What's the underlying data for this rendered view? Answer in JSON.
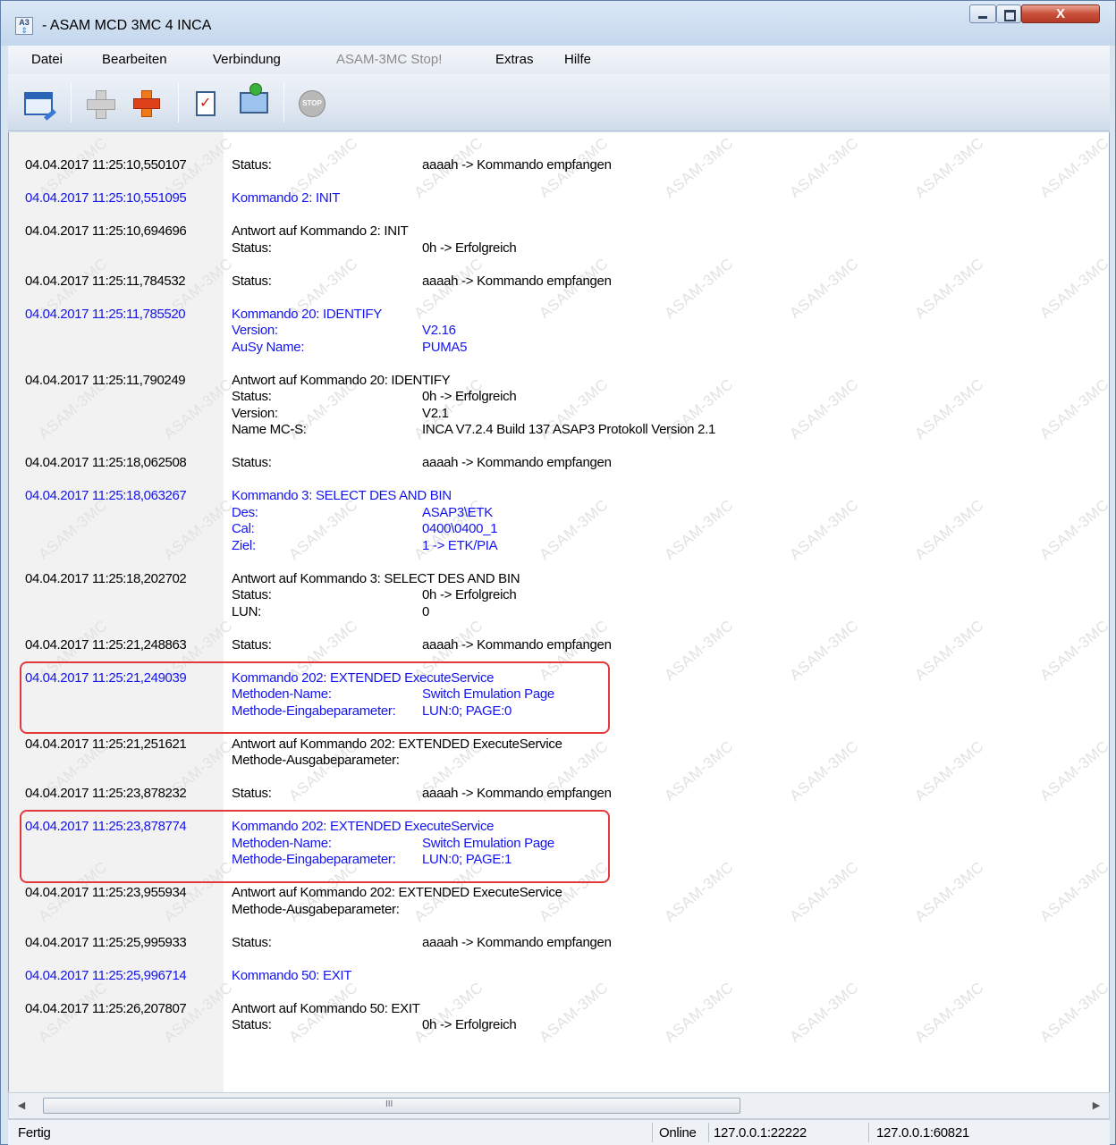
{
  "window": {
    "title": "- ASAM MCD 3MC 4 INCA",
    "icon": "asam-app-icon",
    "icon_text": "A3",
    "close_glyph": "X"
  },
  "menu": {
    "items": [
      "Datei",
      "Bearbeiten",
      "Verbindung",
      "ASAM-3MC Stop!",
      "Extras",
      "Hilfe"
    ]
  },
  "toolbar": {
    "buttons": [
      {
        "icon": "open-window-icon"
      },
      {
        "icon": "add-icon",
        "enabled": false
      },
      {
        "icon": "remove-icon"
      },
      {
        "icon": "checklist-icon"
      },
      {
        "icon": "monitor-connect-icon"
      },
      {
        "icon": "stop-icon",
        "label": "STOP",
        "enabled": false
      }
    ]
  },
  "watermark": "ASAM-3MC",
  "log": [
    {
      "ts": "04.04.2017 11:25:10,550107",
      "color": "black",
      "lines": [
        {
          "label": "Status:",
          "value": "aaaah -> Kommando empfangen"
        }
      ]
    },
    {
      "ts": "04.04.2017 11:25:10,551095",
      "color": "blue",
      "lines": [
        {
          "label": "Kommando 2: INIT",
          "value": ""
        }
      ]
    },
    {
      "ts": "04.04.2017 11:25:10,694696",
      "color": "black",
      "lines": [
        {
          "label": "Antwort auf Kommando 2: INIT",
          "value": ""
        },
        {
          "label": "Status:",
          "value": "0h -> Erfolgreich"
        }
      ]
    },
    {
      "ts": "04.04.2017 11:25:11,784532",
      "color": "black",
      "lines": [
        {
          "label": "Status:",
          "value": "aaaah -> Kommando empfangen"
        }
      ]
    },
    {
      "ts": "04.04.2017 11:25:11,785520",
      "color": "blue",
      "lines": [
        {
          "label": "Kommando 20: IDENTIFY",
          "value": ""
        },
        {
          "label": "Version:",
          "value": "V2.16"
        },
        {
          "label": "AuSy Name:",
          "value": "PUMA5"
        }
      ]
    },
    {
      "ts": "04.04.2017 11:25:11,790249",
      "color": "black",
      "lines": [
        {
          "label": "Antwort auf Kommando 20: IDENTIFY",
          "value": ""
        },
        {
          "label": "Status:",
          "value": "0h -> Erfolgreich"
        },
        {
          "label": "Version:",
          "value": "V2.1"
        },
        {
          "label": "Name MC-S:",
          "value": "INCA V7.2.4 Build 137 ASAP3 Protokoll Version 2.1"
        }
      ]
    },
    {
      "ts": "04.04.2017 11:25:18,062508",
      "color": "black",
      "lines": [
        {
          "label": "Status:",
          "value": "aaaah -> Kommando empfangen"
        }
      ]
    },
    {
      "ts": "04.04.2017 11:25:18,063267",
      "color": "blue",
      "lines": [
        {
          "label": "Kommando 3: SELECT DES AND BIN",
          "value": ""
        },
        {
          "label": "Des:",
          "value": "ASAP3\\ETK"
        },
        {
          "label": "Cal:",
          "value": "0400\\0400_1"
        },
        {
          "label": "Ziel:",
          "value": "1 -> ETK/PIA"
        }
      ]
    },
    {
      "ts": "04.04.2017 11:25:18,202702",
      "color": "black",
      "lines": [
        {
          "label": "Antwort auf Kommando 3: SELECT DES AND BIN",
          "value": ""
        },
        {
          "label": "Status:",
          "value": "0h -> Erfolgreich"
        },
        {
          "label": "LUN:",
          "value": "0"
        }
      ]
    },
    {
      "ts": "04.04.2017 11:25:21,248863",
      "color": "black",
      "lines": [
        {
          "label": "Status:",
          "value": "aaaah -> Kommando empfangen"
        }
      ]
    },
    {
      "ts": "04.04.2017 11:25:21,249039",
      "color": "blue",
      "highlight": true,
      "lines": [
        {
          "label": "Kommando 202: EXTENDED ExecuteService",
          "value": ""
        },
        {
          "label": "Methoden-Name:",
          "value": "Switch Emulation Page"
        },
        {
          "label": "Methode-Eingabeparameter:",
          "value": "LUN:0; PAGE:0"
        }
      ]
    },
    {
      "ts": "04.04.2017 11:25:21,251621",
      "color": "black",
      "lines": [
        {
          "label": "Antwort auf Kommando 202: EXTENDED ExecuteService",
          "value": ""
        },
        {
          "label": "Methode-Ausgabeparameter:",
          "value": ""
        }
      ]
    },
    {
      "ts": "04.04.2017 11:25:23,878232",
      "color": "black",
      "lines": [
        {
          "label": "Status:",
          "value": "aaaah -> Kommando empfangen"
        }
      ]
    },
    {
      "ts": "04.04.2017 11:25:23,878774",
      "color": "blue",
      "highlight": true,
      "lines": [
        {
          "label": "Kommando 202: EXTENDED ExecuteService",
          "value": ""
        },
        {
          "label": "Methoden-Name:",
          "value": "Switch Emulation Page"
        },
        {
          "label": "Methode-Eingabeparameter:",
          "value": "LUN:0; PAGE:1"
        }
      ]
    },
    {
      "ts": "04.04.2017 11:25:23,955934",
      "color": "black",
      "lines": [
        {
          "label": "Antwort auf Kommando 202: EXTENDED ExecuteService",
          "value": ""
        },
        {
          "label": "Methode-Ausgabeparameter:",
          "value": ""
        }
      ]
    },
    {
      "ts": "04.04.2017 11:25:25,995933",
      "color": "black",
      "lines": [
        {
          "label": "Status:",
          "value": "aaaah -> Kommando empfangen"
        }
      ]
    },
    {
      "ts": "04.04.2017 11:25:25,996714",
      "color": "blue",
      "lines": [
        {
          "label": "Kommando 50: EXIT",
          "value": ""
        }
      ]
    },
    {
      "ts": "04.04.2017 11:25:26,207807",
      "color": "black",
      "lines": [
        {
          "label": "Antwort auf Kommando 50: EXIT",
          "value": ""
        },
        {
          "label": "Status:",
          "value": "0h -> Erfolgreich"
        }
      ]
    }
  ],
  "scrollbar": {
    "left_arrow": "◀",
    "right_arrow": "▶",
    "grip": "III"
  },
  "status": {
    "left": "Fertig",
    "connection": "Online",
    "local_address": "127.0.0.1:22222",
    "remote_address": "127.0.0.1:60821"
  },
  "colors": {
    "command_text": "#1414f0",
    "highlight_border": "#e23a3a"
  }
}
